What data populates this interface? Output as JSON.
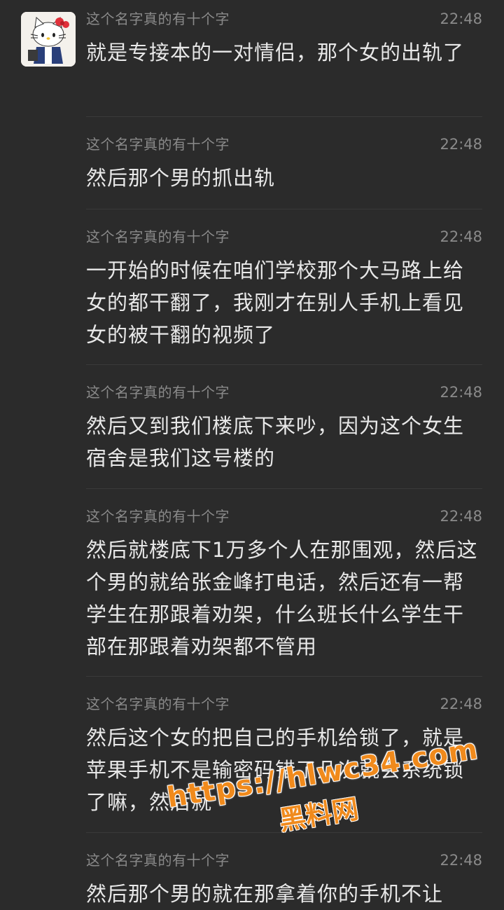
{
  "messages": [
    {
      "sender": "这个名字真的有十个字",
      "time": "22:48",
      "text": "就是专接本的一对情侣，那个女的出轨了"
    },
    {
      "sender": "这个名字真的有十个字",
      "time": "22:48",
      "text": "然后那个男的抓出轨"
    },
    {
      "sender": "这个名字真的有十个字",
      "time": "22:48",
      "text": "一开始的时候在咱们学校那个大马路上给女的都干翻了，我刚才在别人手机上看见女的被干翻的视频了"
    },
    {
      "sender": "这个名字真的有十个字",
      "time": "22:48",
      "text": "然后又到我们楼底下来吵，因为这个女生宿舍是我们这号楼的"
    },
    {
      "sender": "这个名字真的有十个字",
      "time": "22:48",
      "text": "然后就楼底下1万多个人在那围观，然后这个男的就给张金峰打电话，然后还有一帮学生在那跟着劝架，什么班长什么学生干部在那跟着劝架都不管用"
    },
    {
      "sender": "这个名字真的有十个字",
      "time": "22:48",
      "text": "然后这个女的把自己的手机给锁了，就是苹果手机不是输密码错了几次就会系统锁了嘛，然后就"
    },
    {
      "sender": "这个名字真的有十个字",
      "time": "22:48",
      "text": "然后那个男的就在那拿着你的手机不让"
    }
  ],
  "watermark": {
    "url": "https://hlwc34.com",
    "label": "黑料网"
  },
  "colors": {
    "background": "#2b2b2b",
    "text": "#e8e8e8",
    "meta": "#8a8a8a",
    "watermark": "#f08a1c"
  }
}
